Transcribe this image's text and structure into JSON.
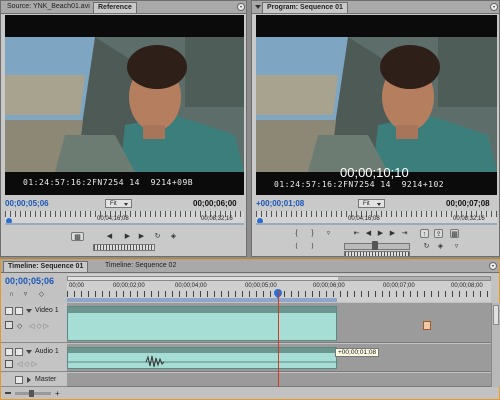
{
  "source_panel": {
    "tabs": [
      "Source: YNK_Beach01.avi",
      "Reference"
    ],
    "video_timecode": "01:24:57:16:2FN7254 14  9214+09B",
    "current_time": "00;00;05;06",
    "fit_label": "Fit",
    "duration": "00;00;06;00",
    "ruler_labels": [
      "00;04;16;08",
      "00;08;32;16"
    ]
  },
  "program_panel": {
    "tab": "Program: Sequence 01",
    "video_timecode": "01:24:57:16:2FN7254 14  9214+102",
    "overlay_timecode": "00;00;10;10",
    "current_time": "+00;00;01;08",
    "fit_label": "Fit",
    "duration": "00;00;07;08",
    "ruler_labels": [
      "00;04;16;08",
      "00;08;32;16"
    ]
  },
  "timeline": {
    "tabs": [
      "Timeline: Sequence 01",
      "Timeline: Sequence 02"
    ],
    "current_time": "00;00;05;06",
    "ruler_labels": [
      "00;00",
      "00;00;02;00",
      "00;00;04;00",
      "00;00;05;00",
      "00;00;06;00",
      "00;00;07;00",
      "00;00;08;00"
    ],
    "tracks": {
      "video": "Video 1",
      "audio": "Audio 1",
      "master": "Master"
    },
    "trim_tooltip": "+00;00;01;08"
  },
  "icons": {
    "play": "play-icon",
    "step_back": "step-back-icon",
    "step_forward": "step-forward-icon",
    "mark_in": "mark-in-icon",
    "mark_out": "mark-out-icon",
    "eye": "eye-icon",
    "speaker": "speaker-icon",
    "panel_menu": "panel-menu-icon"
  },
  "colors": {
    "timecode_blue": "#1a56b8",
    "clip_fill": "#a6ddd4",
    "playhead": "#d03a22",
    "timeline_border": "#e59a2c"
  }
}
